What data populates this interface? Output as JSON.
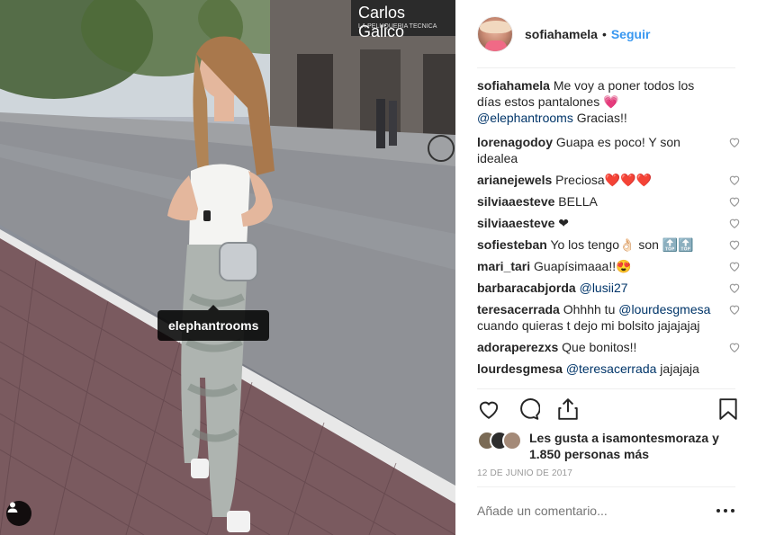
{
  "photo": {
    "storefront_sign": "Carlos Galico",
    "storefront_subsign": "LA PELUQUERIA TECNICA",
    "tag_label": "elephantrooms",
    "icons": {
      "user_tag": "user-tag-icon"
    }
  },
  "post": {
    "username": "sofiahamela",
    "separator": "•",
    "follow_label": "Seguir",
    "caption": {
      "user": "sofiahamela",
      "text_before": " Me voy a poner todos los días estos pantalones 💗 ",
      "mention": "@elephantrooms",
      "text_after": " Gracias!!"
    },
    "comments": [
      {
        "user": "lorenagodoy",
        "text": " Guapa es poco! Y son idealea"
      },
      {
        "user": "arianejewels",
        "text": " Preciosa❤️❤️❤️"
      },
      {
        "user": "silviaaesteve",
        "text": " BELLA"
      },
      {
        "user": "silviaaesteve",
        "text": " ❤"
      },
      {
        "user": "sofiesteban",
        "text": " Yo los tengo👌🏻 son 🔝🔝"
      },
      {
        "user": "mari_tari",
        "text": " Guapísimaaa!!😍"
      },
      {
        "user": "barbaracabjorda",
        "text": " ",
        "mention": "@lusii27"
      },
      {
        "user": "teresacerrada",
        "text": " Ohhhh tu ",
        "mention": "@lourdesgmesa",
        "text_after": " cuando quieras t dejo mi bolsito jajajajaj"
      },
      {
        "user": "adoraperezxs",
        "text": " Que bonitos!!"
      },
      {
        "user": "lourdesgmesa",
        "text": " ",
        "mention": "@teresacerrada",
        "text_after": " jajajaja"
      }
    ],
    "likes_text": "Les gusta a isamontesmoraza y 1.850 personas más",
    "date": "12 DE JUNIO DE 2017",
    "add_comment_placeholder": "Añade un comentario...",
    "icons": {
      "like": "heart-icon",
      "comment": "comment-icon",
      "share": "share-icon",
      "save": "bookmark-icon",
      "more": "more-options-icon"
    },
    "colors": {
      "link": "#3897f0",
      "mention": "#003569",
      "muted": "#999999",
      "text": "#262626"
    }
  }
}
